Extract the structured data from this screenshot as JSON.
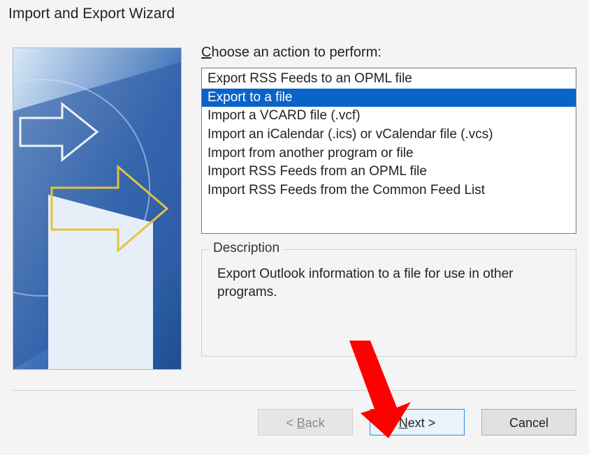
{
  "window": {
    "title": "Import and Export Wizard"
  },
  "action_label": {
    "hotkey": "C",
    "rest": "hoose an action to perform:"
  },
  "actions": [
    {
      "label": "Export RSS Feeds to an OPML file",
      "selected": false
    },
    {
      "label": "Export to a file",
      "selected": true
    },
    {
      "label": "Import a VCARD file (.vcf)",
      "selected": false
    },
    {
      "label": "Import an iCalendar (.ics) or vCalendar file (.vcs)",
      "selected": false
    },
    {
      "label": "Import from another program or file",
      "selected": false
    },
    {
      "label": "Import RSS Feeds from an OPML file",
      "selected": false
    },
    {
      "label": "Import RSS Feeds from the Common Feed List",
      "selected": false
    }
  ],
  "description": {
    "heading": "Description",
    "text": "Export Outlook information to a file for use in other programs."
  },
  "buttons": {
    "back": {
      "prefix": "< ",
      "hotkey": "B",
      "rest": "ack",
      "enabled": false
    },
    "next": {
      "hotkey": "N",
      "rest": "ext >",
      "enabled": true,
      "primary": true
    },
    "cancel": {
      "label": "Cancel",
      "enabled": true
    }
  },
  "annotation_arrow": {
    "color": "#ff0000"
  }
}
